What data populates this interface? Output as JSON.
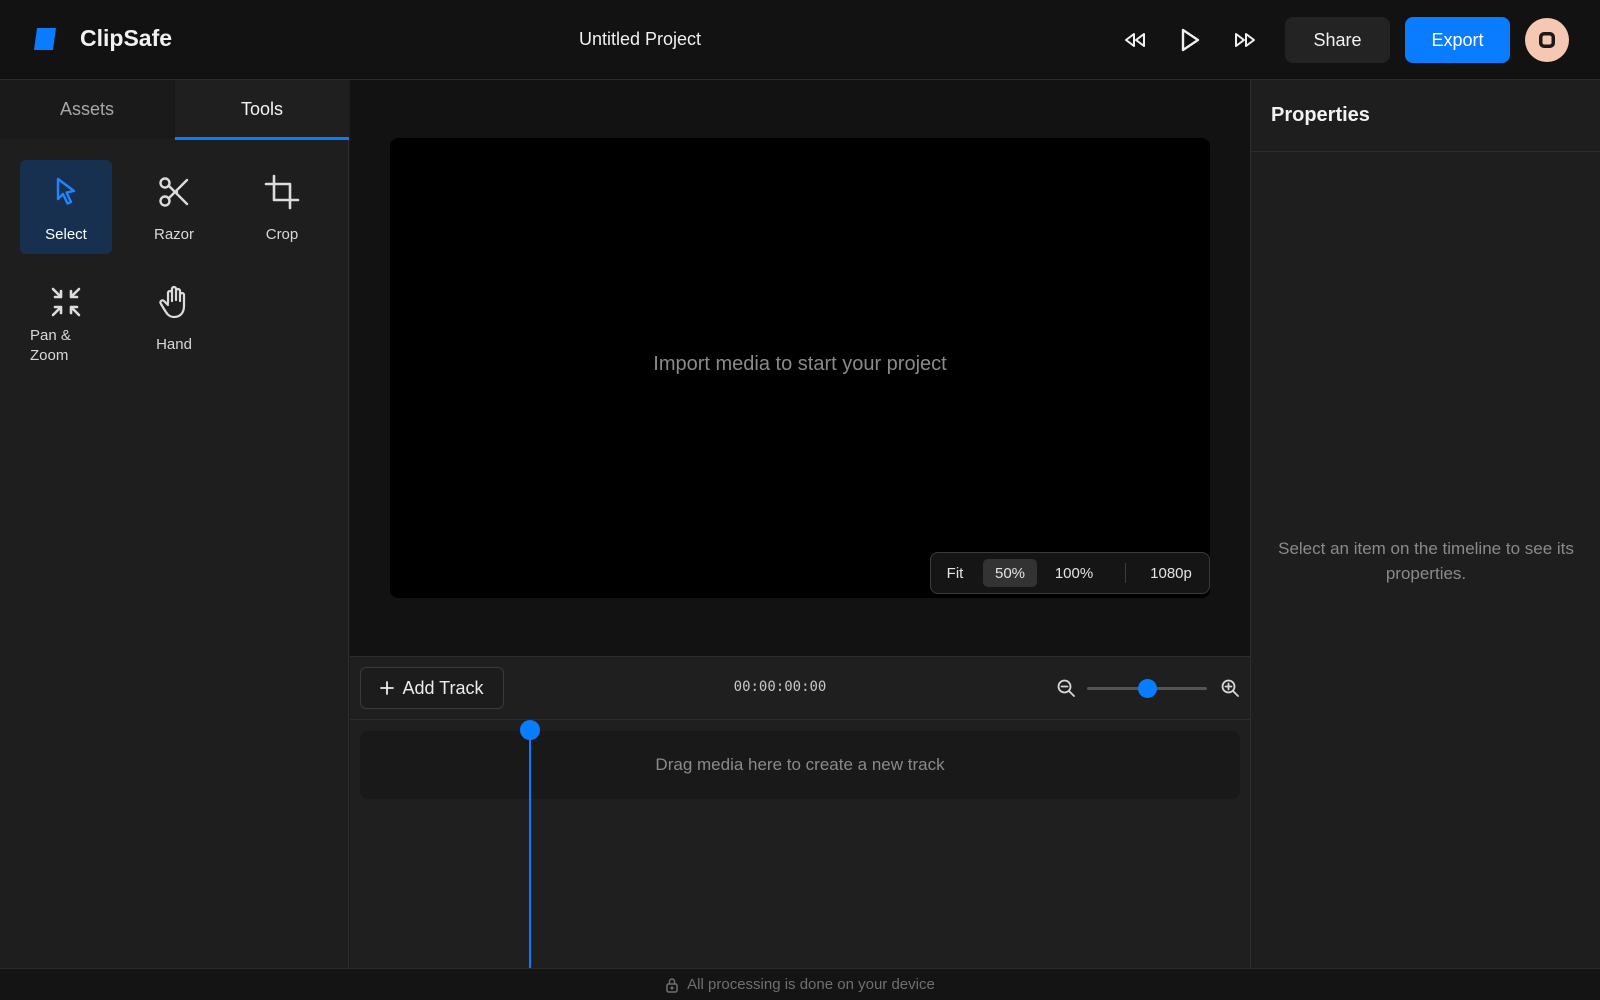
{
  "app": {
    "name": "ClipSafe",
    "project_title": "Untitled Project"
  },
  "header": {
    "share_label": "Share",
    "export_label": "Export",
    "icons": [
      "logo-icon",
      "rewind-icon",
      "play-icon",
      "fast-forward-icon",
      "record-icon"
    ]
  },
  "sidebar": {
    "tabs": [
      {
        "label": "Assets",
        "active": false
      },
      {
        "label": "Tools",
        "active": true
      }
    ],
    "tools": [
      {
        "label": "Select",
        "icon": "cursor-icon",
        "active": true
      },
      {
        "label": "Razor",
        "icon": "scissors-icon",
        "active": false
      },
      {
        "label": "Crop",
        "icon": "crop-icon",
        "active": false
      },
      {
        "label": "Pan & Zoom",
        "icon": "minimize-icon",
        "active": false
      },
      {
        "label": "Hand",
        "icon": "hand-icon",
        "active": false
      }
    ]
  },
  "preview": {
    "empty_message": "Import media to start your project",
    "zoom_options": [
      "Fit",
      "50%",
      "100%"
    ],
    "selected_zoom": "50%",
    "resolution": "1080p"
  },
  "timeline": {
    "add_track_label": "Add Track",
    "timecode": "00:00:00:00",
    "zoom_level": 0.5,
    "drop_message": "Drag media here to create a new track"
  },
  "properties": {
    "title": "Properties",
    "empty_message": "Select an item on the timeline to see its properties."
  },
  "footer": {
    "message": "All processing is done on your device"
  },
  "colors": {
    "accent": "#0a7cff",
    "background": "#121212",
    "panel": "#1e1e1e",
    "avatar": "#f6c8b2"
  }
}
